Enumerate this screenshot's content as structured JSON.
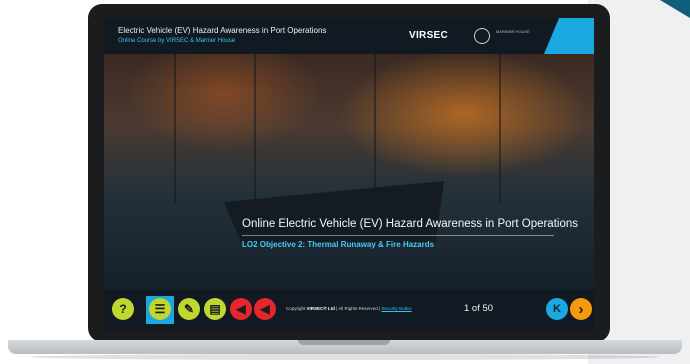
{
  "header": {
    "course_title": "Electric Vehicle (EV) Hazard Awareness in Port Operations",
    "course_subtitle": "Online Course by VIRSEC & Marnier House",
    "logo_virsec": "VIRSEC",
    "logo_partner": "MARINER HOUSE"
  },
  "hero": {
    "title": "Online Electric Vehicle (EV) Hazard Awareness in Port Operations",
    "subtitle": "LO2 Objective 2: Thermal Runaway & Fire Hazards"
  },
  "footer": {
    "controls": [
      {
        "name": "help-icon",
        "glyph": "?",
        "color": "#bfd72e"
      },
      {
        "name": "menu-list-icon",
        "glyph": "☰",
        "color": "#bfd72e"
      },
      {
        "name": "notes-pencil-icon",
        "glyph": "✎",
        "color": "#bfd72e"
      },
      {
        "name": "document-icon",
        "glyph": "▤",
        "color": "#bfd72e"
      },
      {
        "name": "audio-icon",
        "glyph": "◀",
        "color": "#e6252d"
      },
      {
        "name": "volume-icon",
        "glyph": "◀",
        "color": "#e6252d"
      }
    ],
    "copyright_prefix": "Copyright",
    "copyright_brand": "VIRSEC® Ltd",
    "copyright_suffix": "| All Rights Reserved |",
    "security_notice": "Security Notice",
    "page_indicator": "1 of 50",
    "prev_glyph": "K",
    "next_glyph": "›"
  },
  "colors": {
    "accent_blue": "#1ba8e0",
    "accent_yellow": "#bfd72e",
    "accent_red": "#e6252d",
    "accent_orange": "#f59a0e"
  }
}
